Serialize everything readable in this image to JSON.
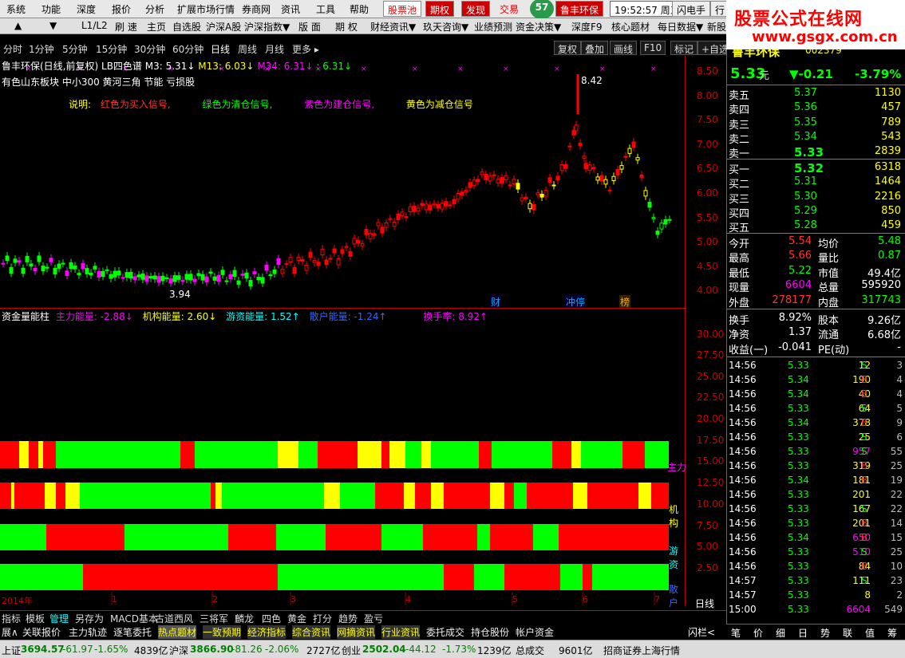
{
  "menubar": {
    "items": [
      "系统",
      "功能",
      "深度",
      "报价",
      "分析",
      "扩展市场行情",
      "券商网",
      "资讯",
      "工具",
      "帮助"
    ],
    "highlight": [
      "股票池",
      "期权",
      "发现"
    ],
    "trade": "交易",
    "score": "57",
    "stock_tag": "鲁丰环保",
    "time": "19:52:57 周三",
    "right": [
      "闪电手",
      "行"
    ]
  },
  "watermark": {
    "line1": "股票公式在线网",
    "line2": "www.gsgx.com.cn"
  },
  "toolbar": {
    "items": [
      "▲",
      "▼",
      "L1/L2",
      "刷 速",
      "主页",
      "自选股",
      "沪深A股",
      "沪深指数▼",
      "版 面",
      "期 权",
      "财经资讯▼",
      "玖天咨询▼",
      "业绩预测",
      "资金决策▼",
      "深度F9",
      "核心题材",
      "每日数据▼",
      "新股"
    ]
  },
  "periods": {
    "items": [
      "分时",
      "1分钟",
      "5分钟",
      "15分钟",
      "30分钟",
      "60分钟",
      "日线",
      "周线",
      "月线",
      "更多 ▸"
    ],
    "active": "日线",
    "right_buttons": [
      "复权",
      "叠加",
      "画线",
      "F10",
      "标记",
      "+自选"
    ]
  },
  "chart": {
    "legend_name": "鲁丰环保(日线,前复权)",
    "legend_lb": "LB四色谱",
    "m3": "M3: 5.31↓",
    "m13": "M13: 6.03↓",
    "m34": "M34: 6.31↓",
    "colon": ": 6.31↓",
    "tags": "有色山东板块  中小300 黄河三角 节能  亏损股",
    "note_label": "说明:",
    "note_red": "红色为买入信号,",
    "note_green": "绿色为清仓信号,",
    "note_purple": "紫色为建仓信号,",
    "note_yellow": "黄色为减仓信号",
    "high_label": "8.42",
    "low_label": "3.94",
    "event_tags": [
      "财",
      "冲停",
      "榜"
    ],
    "y_ticks": [
      "8.50",
      "8.00",
      "7.50",
      "7.00",
      "6.50",
      "6.00",
      "5.50",
      "5.00",
      "4.50",
      "4.00"
    ]
  },
  "indicator": {
    "title": "资金量能柱",
    "main_force": "主力能量: -2.88↓",
    "institution": "机构能量: 2.60↓",
    "retail_hot": "游资能量: 1.52↑",
    "retail": "散户能量: -1.24↑",
    "turnover": "换手率: 8.92↑",
    "y_ticks": [
      "30.00",
      "27.50",
      "25.00",
      "22.50",
      "20.00",
      "17.50",
      "15.00",
      "12.50",
      "10.00",
      "7.50",
      "5.00",
      "2.50"
    ],
    "row_labels": [
      "主力",
      "机构",
      "游资",
      "散户"
    ],
    "x_labels": [
      "2014年",
      "1",
      "2",
      "3",
      "4",
      "5",
      "6",
      "7",
      "8"
    ],
    "period_label": "日线"
  },
  "colors": {
    "red": "#ff0000",
    "green": "#00ff00",
    "yellow": "#ffff00",
    "purple": "#ff00ff"
  },
  "bottomtabs": {
    "items": [
      "指标",
      "模板",
      "管理",
      "另存为",
      "MACD基本",
      "古道西风",
      "三将军",
      "麟龙",
      "四色",
      "黄金",
      "打分",
      "趋势",
      "盈亏"
    ],
    "active": "管理"
  },
  "subtabs": {
    "items": [
      "展∧",
      "关联报价",
      "主力轨迹",
      "逐笔委托",
      "热点题材",
      "一致预期",
      "经济指标",
      "综合资讯",
      "网摘资讯",
      "行业资讯",
      "委托成交",
      "持仓股份",
      "帐户资金"
    ]
  },
  "statusbar": {
    "sh_label": "上证",
    "sh_val": "3694.57",
    "sh_chg": "-61.97",
    "sh_pct": "-1.65%",
    "sh_amt": "4839亿",
    "sz_label": "沪深",
    "sz_val": "3866.90",
    "sz_chg": "-81.26",
    "sz_pct": "-2.06%",
    "sz_amt": "2727亿",
    "cy_label": "创业",
    "cy_val": "2502.04",
    "cy_chg": "-44.12",
    "cy_pct": "-1.73%",
    "cy_amt": "1239亿",
    "total_label": "总成交",
    "total_val": "9601亿",
    "broker": "招商证券上海行情"
  },
  "quote": {
    "name": "鲁丰环保",
    "code": "002379",
    "price": "5.33",
    "price_unit": "元",
    "change": "▼-0.21",
    "pct": "-3.79%",
    "asks": [
      {
        "label": "卖五",
        "price": "5.37",
        "vol": "1130"
      },
      {
        "label": "卖四",
        "price": "5.36",
        "vol": "457"
      },
      {
        "label": "卖三",
        "price": "5.35",
        "vol": "789"
      },
      {
        "label": "卖二",
        "price": "5.34",
        "vol": "543"
      },
      {
        "label": "卖一",
        "price": "5.33",
        "vol": "2839"
      }
    ],
    "bids": [
      {
        "label": "买一",
        "price": "5.32",
        "vol": "6318"
      },
      {
        "label": "买二",
        "price": "5.31",
        "vol": "1464"
      },
      {
        "label": "买三",
        "price": "5.30",
        "vol": "2216"
      },
      {
        "label": "买四",
        "price": "5.29",
        "vol": "850"
      },
      {
        "label": "买五",
        "price": "5.28",
        "vol": "459"
      }
    ],
    "stats": [
      {
        "l1": "今开",
        "v1": "5.54",
        "l2": "均价",
        "v2": "5.48",
        "c1": "#ff3333",
        "c2": "#00ff00"
      },
      {
        "l1": "最高",
        "v1": "5.66",
        "l2": "量比",
        "v2": "0.87",
        "c1": "#ff3333",
        "c2": "#00ff00"
      },
      {
        "l1": "最低",
        "v1": "5.22",
        "l2": "市值",
        "v2": "49.4亿",
        "c1": "#00ff00",
        "c2": "#ffffff"
      },
      {
        "l1": "现量",
        "v1": "6604",
        "l2": "总量",
        "v2": "595920",
        "c1": "#ff00ff",
        "c2": "#ffffff"
      },
      {
        "l1": "外盘",
        "v1": "278177",
        "l2": "内盘",
        "v2": "317743",
        "c1": "#ff3333",
        "c2": "#00ff00"
      }
    ],
    "stats2": [
      {
        "l1": "换手",
        "v1": "8.92%",
        "l2": "股本",
        "v2": "9.26亿"
      },
      {
        "l1": "净资",
        "v1": "1.37",
        "l2": "流通",
        "v2": "6.68亿"
      },
      {
        "l1": "收益(一)",
        "v1": "-0.041",
        "l2": "PE(动)",
        "v2": "-"
      }
    ],
    "ticks": [
      {
        "t": "14:56",
        "p": "5.33",
        "v": "12",
        "d": "S",
        "n": "3"
      },
      {
        "t": "14:56",
        "p": "5.34",
        "v": "190",
        "d": "B",
        "n": "4"
      },
      {
        "t": "14:56",
        "p": "5.34",
        "v": "40",
        "d": "B",
        "n": "4"
      },
      {
        "t": "14:56",
        "p": "5.33",
        "v": "64",
        "d": "S",
        "n": "5"
      },
      {
        "t": "14:56",
        "p": "5.34",
        "v": "378",
        "d": "B",
        "n": "9"
      },
      {
        "t": "14:56",
        "p": "5.33",
        "v": "25",
        "d": "S",
        "n": "6"
      },
      {
        "t": "14:56",
        "p": "5.33",
        "v": "957",
        "d": "S",
        "n": "55"
      },
      {
        "t": "14:56",
        "p": "5.33",
        "v": "319",
        "d": "B",
        "n": "25"
      },
      {
        "t": "14:56",
        "p": "5.34",
        "v": "181",
        "d": "B",
        "n": "19"
      },
      {
        "t": "14:56",
        "p": "5.33",
        "v": "201",
        "d": "",
        "n": "22"
      },
      {
        "t": "14:56",
        "p": "5.33",
        "v": "167",
        "d": "S",
        "n": "22"
      },
      {
        "t": "14:56",
        "p": "5.33",
        "v": "201",
        "d": "B",
        "n": "14"
      },
      {
        "t": "14:56",
        "p": "5.34",
        "v": "650",
        "d": "B",
        "n": "15"
      },
      {
        "t": "14:56",
        "p": "5.33",
        "v": "510",
        "d": "S",
        "n": "25"
      },
      {
        "t": "14:56",
        "p": "5.33",
        "v": "84",
        "d": "B",
        "n": "10"
      },
      {
        "t": "14:57",
        "p": "5.33",
        "v": "111",
        "d": "S",
        "n": "23"
      },
      {
        "t": "14:57",
        "p": "5.33",
        "v": "8",
        "d": "",
        "n": "2"
      },
      {
        "t": "15:00",
        "p": "5.33",
        "v": "6604",
        "d": "",
        "n": "549"
      }
    ]
  },
  "bottomnav": {
    "items": [
      "笔",
      "价",
      "细",
      "日",
      "势",
      "联",
      "值",
      "筹"
    ],
    "left": "闪栏<"
  }
}
